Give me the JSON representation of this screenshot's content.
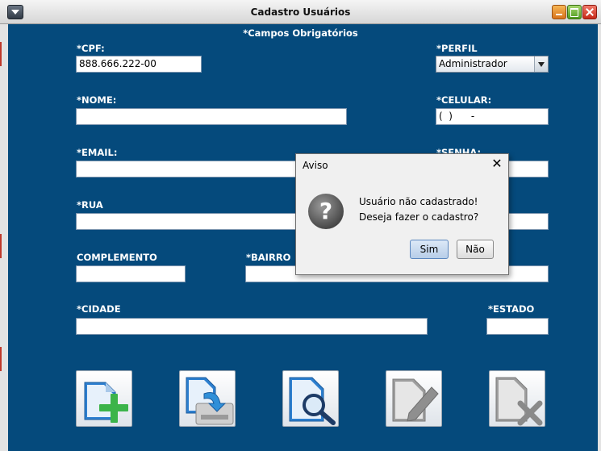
{
  "window": {
    "title": "Cadastro Usuários"
  },
  "form": {
    "required_note": "*Campos Obrigatórios",
    "cpf": {
      "label": "*CPF:",
      "value": "888.666.222-00"
    },
    "perfil": {
      "label": "*PERFIL",
      "selected": "Administrador"
    },
    "nome": {
      "label": "*NOME:",
      "value": ""
    },
    "celular": {
      "label": "*CELULAR:",
      "value": "(  )      -"
    },
    "email": {
      "label": "*EMAIL:",
      "value": ""
    },
    "senha": {
      "label": "*SENHA:",
      "value": ""
    },
    "rua": {
      "label": "*RUA",
      "value": ""
    },
    "numero": {
      "value": ""
    },
    "complemento": {
      "label": "COMPLEMENTO",
      "value": ""
    },
    "bairro": {
      "label": "*BAIRRO",
      "value": ""
    },
    "cidade": {
      "label": "*CIDADE",
      "value": ""
    },
    "estado": {
      "label": "*ESTADO",
      "value": ""
    }
  },
  "toolbar": {
    "buttons": [
      {
        "icon": "add-document-icon",
        "enabled": true
      },
      {
        "icon": "save-document-icon",
        "enabled": true
      },
      {
        "icon": "search-document-icon",
        "enabled": true
      },
      {
        "icon": "edit-document-icon",
        "enabled": false
      },
      {
        "icon": "delete-document-icon",
        "enabled": false
      }
    ]
  },
  "dialog": {
    "title": "Aviso",
    "line1": "Usuário não cadastrado!",
    "line2": "Deseja fazer o cadastro?",
    "yes_label": "Sim",
    "no_label": "Não",
    "icon": "question-icon"
  },
  "colors": {
    "form_background": "#054a7c",
    "label_text": "#ffffff"
  }
}
